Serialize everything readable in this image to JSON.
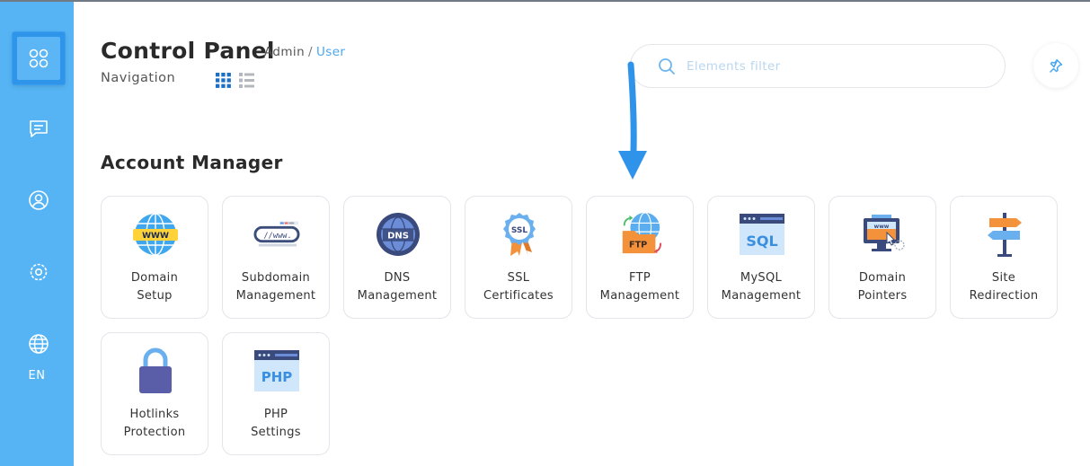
{
  "sidebar": {
    "items": [
      {
        "name": "apps-grid-icon"
      },
      {
        "name": "chat-icon"
      },
      {
        "name": "user-icon"
      },
      {
        "name": "settings-icon"
      },
      {
        "name": "globe-icon"
      }
    ],
    "language": "EN"
  },
  "header": {
    "title": "Control Panel",
    "breadcrumb": [
      "Admin",
      "User"
    ],
    "breadcrumb_separator": "/",
    "navigation_label": "Navigation",
    "view_modes": [
      "grid-view-icon",
      "list-view-icon"
    ],
    "active_view": "grid"
  },
  "search": {
    "placeholder": "Elements filter",
    "value": ""
  },
  "section": {
    "title": "Account Manager",
    "tiles": [
      {
        "line1": "Domain",
        "line2": "Setup",
        "icon": "www-globe-icon"
      },
      {
        "line1": "Subdomain",
        "line2": "Management",
        "icon": "subdomain-link-icon"
      },
      {
        "line1": "DNS",
        "line2": "Management",
        "icon": "dns-globe-icon"
      },
      {
        "line1": "SSL",
        "line2": "Certificates",
        "icon": "ssl-badge-icon"
      },
      {
        "line1": "FTP",
        "line2": "Management",
        "icon": "ftp-folder-icon"
      },
      {
        "line1": "MySQL",
        "line2": "Management",
        "icon": "sql-window-icon"
      },
      {
        "line1": "Domain",
        "line2": "Pointers",
        "icon": "domain-pointer-icon"
      },
      {
        "line1": "Site",
        "line2": "Redirection",
        "icon": "signpost-icon"
      },
      {
        "line1": "Hotlinks",
        "line2": "Protection",
        "icon": "padlock-icon"
      },
      {
        "line1": "PHP",
        "line2": "Settings",
        "icon": "php-window-icon"
      }
    ]
  },
  "colors": {
    "sidebar": "#56b4f4",
    "accent": "#4aa7ef",
    "arrow": "#2f93ea"
  }
}
